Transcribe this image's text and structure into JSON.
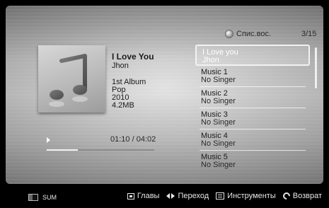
{
  "header": {
    "icon": "music-disc-icon",
    "label": "Спис.вос.",
    "count": "3/15"
  },
  "now_playing": {
    "title": "I Love You",
    "artist": "Jhon",
    "meta": [
      "1st Album",
      "Pop",
      "2010",
      "4.2MB"
    ],
    "time": "01:10 / 04:02",
    "progress": 0.29
  },
  "playlist": {
    "items": [
      {
        "title": "I Love you",
        "singer": "Jhon",
        "selected": true
      },
      {
        "title": "Music 1",
        "singer": "No Singer"
      },
      {
        "title": "Music 2",
        "singer": "No Singer"
      },
      {
        "title": "Music 3",
        "singer": "No Singer"
      },
      {
        "title": "Music 4",
        "singer": "No Singer"
      },
      {
        "title": "Music 5",
        "singer": "No Singer"
      }
    ]
  },
  "bottom_bar": {
    "sum_label": "SUM",
    "actions": [
      {
        "icon": "chapters-icon",
        "label": "Главы"
      },
      {
        "icon": "left-right-arrows-icon",
        "label": "Переход"
      },
      {
        "icon": "tools-icon",
        "label": "Инструменты"
      },
      {
        "icon": "return-icon",
        "label": "Возврат"
      }
    ]
  },
  "colors": {
    "selection_border": "#F2F2F2",
    "bottom_bar_bg": "#000000"
  }
}
